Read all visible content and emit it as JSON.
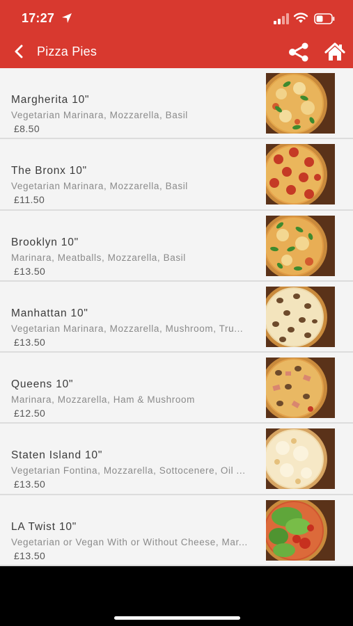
{
  "status_bar": {
    "time": "17:27"
  },
  "header": {
    "title": "Pizza Pies"
  },
  "colors": {
    "accent": "#d8392f",
    "list_bg": "#f4f4f4"
  },
  "icons": {
    "back": "chevron-left-icon",
    "share": "share-icon",
    "home": "home-icon"
  },
  "items": [
    {
      "name": "Margherita 10\"",
      "description": "Vegetarian  Marinara, Mozzarella, Basil",
      "price": "£8.50",
      "image": "margherita-pizza"
    },
    {
      "name": "The Bronx 10\"",
      "description": "Vegetarian  Marinara, Mozzarella, Basil",
      "price": "£11.50",
      "image": "pepperoni-pizza"
    },
    {
      "name": "Brooklyn 10\"",
      "description": "Marinara, Meatballs, Mozzarella, Basil",
      "price": "£13.50",
      "image": "basil-pizza"
    },
    {
      "name": "Manhattan 10\"",
      "description": "Vegetarian  Marinara, Mozzarella,  Mushroom, Tru...",
      "price": "£13.50",
      "image": "mushroom-pizza"
    },
    {
      "name": "Queens 10\"",
      "description": "Marinara, Mozzarella, Ham & Mushroom",
      "price": "£12.50",
      "image": "ham-mushroom-pizza"
    },
    {
      "name": "Staten Island 10\"",
      "description": "Vegetarian  Fontina, Mozzarella, Sottocenere, Oil ...",
      "price": "£13.50",
      "image": "white-pizza"
    },
    {
      "name": "LA Twist 10\"",
      "description": "Vegetarian or Vegan With or Without Cheese, Mar...",
      "price": "£13.50",
      "image": "salad-pizza"
    }
  ]
}
